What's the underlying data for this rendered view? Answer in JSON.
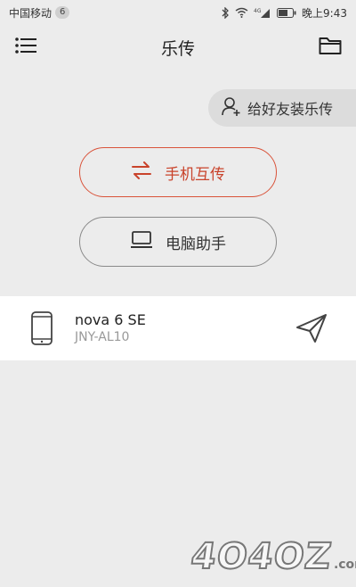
{
  "status_bar": {
    "carrier": "中国移动",
    "carrier_badge": "6",
    "network_label": "4G",
    "time": "晚上9:43"
  },
  "app_bar": {
    "title": "乐传",
    "menu_icon": "list-menu-icon",
    "folder_icon": "folder-icon"
  },
  "invite": {
    "label": "给好友装乐传",
    "icon": "add-user-icon"
  },
  "buttons": {
    "phone_transfer": "手机互传",
    "pc_assistant": "电脑助手"
  },
  "device": {
    "name": "nova 6 SE",
    "model": "JNY-AL10",
    "icon": "phone-icon",
    "action_icon": "send-icon"
  },
  "watermark": {
    "text": "4O4OZ",
    "suffix": ".com"
  },
  "colors": {
    "accent": "#d9533a",
    "background": "#ececec"
  }
}
